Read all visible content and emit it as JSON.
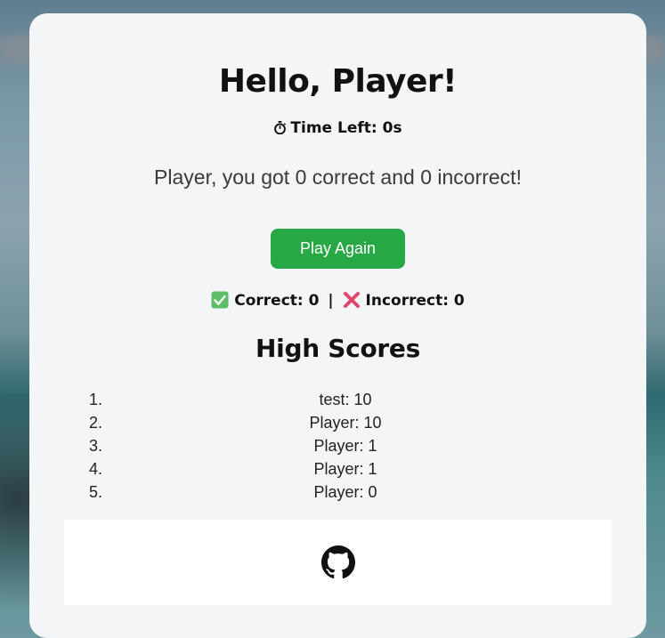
{
  "greeting": "Hello, Player!",
  "timer": {
    "icon": "stopwatch-icon",
    "text": "Time Left: 0s"
  },
  "result_text": "Player, you got 0 correct and 0 incorrect!",
  "play_again_label": "Play Again",
  "tally": {
    "correct_icon": "check-icon",
    "correct_text": "Correct: 0",
    "separator": "|",
    "incorrect_icon": "cross-icon",
    "incorrect_text": "Incorrect: 0"
  },
  "high_scores": {
    "title": "High Scores",
    "entries": [
      {
        "rank": "1.",
        "text": "test: 10"
      },
      {
        "rank": "2.",
        "text": "Player: 10"
      },
      {
        "rank": "3.",
        "text": "Player: 1"
      },
      {
        "rank": "4.",
        "text": "Player: 1"
      },
      {
        "rank": "5.",
        "text": "Player: 0"
      }
    ]
  },
  "footer": {
    "icon": "github-icon"
  },
  "colors": {
    "accent": "#28a745",
    "card": "#f3f5f6",
    "check": "#4caf50",
    "cross": "#e0476b"
  }
}
